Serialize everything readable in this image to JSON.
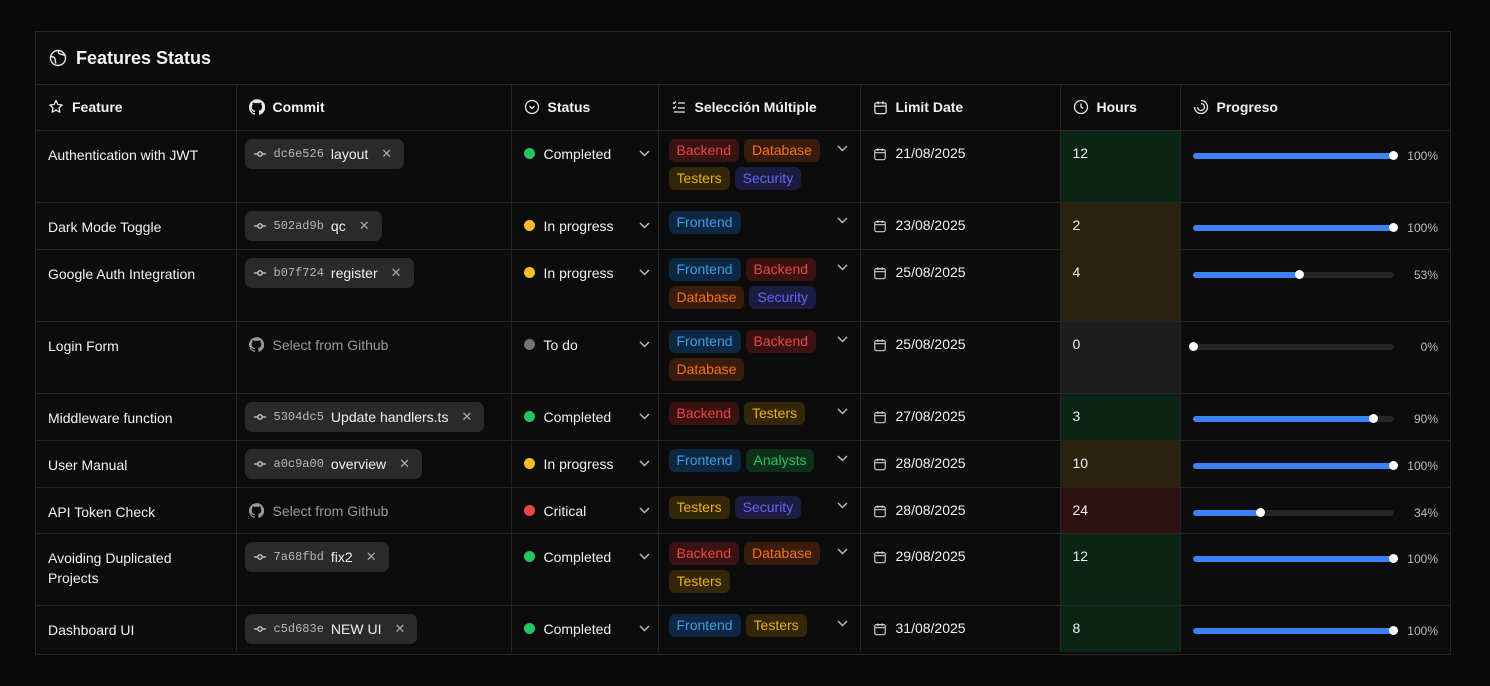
{
  "panel": {
    "title": "Features Status"
  },
  "columns": {
    "feature": "Feature",
    "commit": "Commit",
    "status": "Status",
    "multi": "Selección Múltiple",
    "date": "Limit Date",
    "hours": "Hours",
    "progress": "Progreso"
  },
  "status_colors": {
    "Completed": "#22c55e",
    "In progress": "#fbbf24",
    "To do": "#737373",
    "Critical": "#ef4444"
  },
  "tag_styles": {
    "Backend": {
      "text": "#ef4444",
      "bg": "#3a1212"
    },
    "Database": {
      "text": "#f97316",
      "bg": "#3a1c0d"
    },
    "Testers": {
      "text": "#eab308",
      "bg": "#332609"
    },
    "Security": {
      "text": "#6366f1",
      "bg": "#1c1c40"
    },
    "Frontend": {
      "text": "#3b9eea",
      "bg": "#0d2840"
    },
    "Analysts": {
      "text": "#22c55e",
      "bg": "#0e3018"
    }
  },
  "hours_bg": {
    "Completed": "#0a2416",
    "In progress": "#2b2310",
    "To do": "#1d1d1d",
    "Critical": "#2e1113"
  },
  "gh_placeholder": "Select from Github",
  "rows": [
    {
      "feature": "Authentication with JWT",
      "commit": {
        "hash": "dc6e526",
        "message": "layout"
      },
      "status": "Completed",
      "tags": [
        "Backend",
        "Database",
        "Testers",
        "Security"
      ],
      "date": "21/08/2025",
      "hours": "12",
      "progress": 100,
      "progress_label": "100%"
    },
    {
      "feature": "Dark Mode Toggle",
      "commit": {
        "hash": "502ad9b",
        "message": "qc"
      },
      "status": "In progress",
      "tags": [
        "Frontend"
      ],
      "date": "23/08/2025",
      "hours": "2",
      "progress": 100,
      "progress_label": "100%"
    },
    {
      "feature": "Google Auth Integration",
      "commit": {
        "hash": "b07f724",
        "message": "register"
      },
      "status": "In progress",
      "tags": [
        "Frontend",
        "Backend",
        "Database",
        "Security"
      ],
      "date": "25/08/2025",
      "hours": "4",
      "progress": 53,
      "progress_label": "53%"
    },
    {
      "feature": "Login Form",
      "commit": null,
      "status": "To do",
      "tags": [
        "Frontend",
        "Backend",
        "Database"
      ],
      "date": "25/08/2025",
      "hours": "0",
      "progress": 0,
      "progress_label": "0%"
    },
    {
      "feature": "Middleware function",
      "commit": {
        "hash": "5304dc5",
        "message": "Update handlers.ts"
      },
      "status": "Completed",
      "tags": [
        "Backend",
        "Testers"
      ],
      "date": "27/08/2025",
      "hours": "3",
      "progress": 90,
      "progress_label": "90%"
    },
    {
      "feature": "User Manual",
      "commit": {
        "hash": "a0c9a00",
        "message": "overview"
      },
      "status": "In progress",
      "tags": [
        "Frontend",
        "Analysts"
      ],
      "date": "28/08/2025",
      "hours": "10",
      "progress": 100,
      "progress_label": "100%"
    },
    {
      "feature": "API Token Check",
      "commit": null,
      "status": "Critical",
      "tags": [
        "Testers",
        "Security"
      ],
      "date": "28/08/2025",
      "hours": "24",
      "progress": 34,
      "progress_label": "34%"
    },
    {
      "feature": "Avoiding Duplicated Projects",
      "commit": {
        "hash": "7a68fbd",
        "message": "fix2"
      },
      "status": "Completed",
      "tags": [
        "Backend",
        "Database",
        "Testers"
      ],
      "date": "29/08/2025",
      "hours": "12",
      "progress": 100,
      "progress_label": "100%"
    },
    {
      "feature": "Dashboard UI",
      "commit": {
        "hash": "c5d683e",
        "message": "NEW UI"
      },
      "status": "Completed",
      "tags": [
        "Frontend",
        "Testers"
      ],
      "date": "31/08/2025",
      "hours": "8",
      "progress": 100,
      "progress_label": "100%"
    }
  ]
}
